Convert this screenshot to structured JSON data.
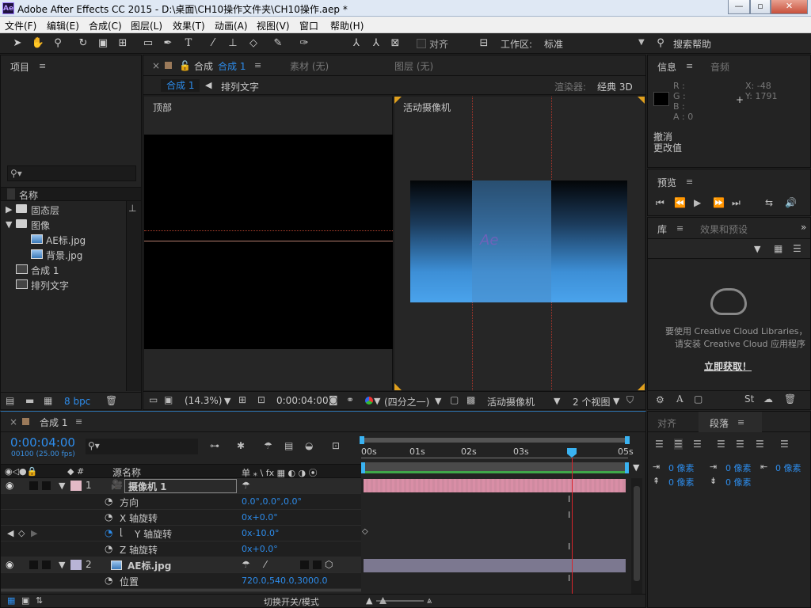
{
  "titlebar": {
    "app_icon": "Ae",
    "title": "Adobe After Effects CC 2015 - D:\\桌面\\CH10操作文件夹\\CH10操作.aep *",
    "minimize": "—",
    "maximize": "▫",
    "close": "✕"
  },
  "menu": [
    "文件(F)",
    "编辑(E)",
    "合成(C)",
    "图层(L)",
    "效果(T)",
    "动画(A)",
    "视图(V)",
    "窗口",
    "帮助(H)"
  ],
  "toolbar": {
    "align_label": "对齐",
    "workspace_label": "工作区:",
    "workspace_value": "标准",
    "search_help": "搜索帮助"
  },
  "project": {
    "title": "项目",
    "name_header": "名称",
    "items": [
      {
        "label": "固态层",
        "type": "folder",
        "expanded": false
      },
      {
        "label": "图像",
        "type": "folder",
        "expanded": true
      },
      {
        "label": "AE标.jpg",
        "type": "image",
        "indent": true
      },
      {
        "label": "背景.jpg",
        "type": "image",
        "indent": true
      },
      {
        "label": "合成 1",
        "type": "comp"
      },
      {
        "label": "排列文字",
        "type": "comp"
      }
    ],
    "bpc": "8 bpc"
  },
  "composition": {
    "tab_prefix": "合成",
    "tab_name": "合成 1",
    "tab_footage": "素材 (无)",
    "tab_layer": "图层 (无)",
    "breadcrumb_active": "合成 1",
    "breadcrumb_next": "排列文字",
    "renderer_label": "渲染器:",
    "renderer_value": "经典 3D",
    "view_left_label": "顶部",
    "view_right_label": "活动摄像机",
    "preview_text": "Ae",
    "footer": {
      "zoom": "(14.3%)",
      "timecode": "0:00:04:00",
      "resolution": "(四分之一)",
      "camera": "活动摄像机",
      "views": "2 个视图"
    }
  },
  "info": {
    "tab_info": "信息",
    "tab_audio": "音频",
    "r": "R :",
    "g": "G :",
    "b": "B :",
    "a": "A : 0",
    "x": "X: -48",
    "y": "Y: 1791",
    "line1": "撤消",
    "line2": "更改值"
  },
  "preview": {
    "title": "预览"
  },
  "library": {
    "tab_library": "库",
    "tab_effects": "效果和预设",
    "msg1": "要使用 Creative Cloud Libraries，",
    "msg2": "请安装 Creative Cloud 应用程序",
    "cta": "立即获取！"
  },
  "timeline": {
    "tab_name": "合成 1",
    "timecode": "0:00:04:00",
    "frames": "00100 (25.00 fps)",
    "col_source": "源名称",
    "col_switches": "单 ⁎ \\ fx ▦ ◐ ◑ ⦿",
    "ruler": [
      "00s",
      "01s",
      "02s",
      "03s",
      "05s"
    ],
    "playhead_fraction": 0.8,
    "layers": [
      {
        "num": "1",
        "name": "摄像机 1",
        "type": "camera",
        "color": "#e3b9c6"
      },
      {
        "prop": "方向",
        "value": "0.0°,0.0°,0.0°"
      },
      {
        "prop": "X 轴旋转",
        "value": "0x+0.0°"
      },
      {
        "prop": "Y 轴旋转",
        "value": "0x-10.0°",
        "keyframed": true
      },
      {
        "prop": "Z 轴旋转",
        "value": "0x+0.0°"
      },
      {
        "num": "2",
        "name": "AE标.jpg",
        "type": "image",
        "color": "#b8b4d6"
      },
      {
        "prop": "位置",
        "value": "720.0,540.0,3000.0"
      }
    ],
    "bottom_label": "切换开关/模式"
  },
  "paragraph": {
    "tab_align": "对齐",
    "tab_paragraph": "段落",
    "indent1": "0 像素",
    "indent2": "0 像素",
    "indent3": "0 像素",
    "space1": "0 像素",
    "space2": "0 像素"
  },
  "colors": {
    "accent": "#2d8ceb",
    "playhead": "#d8242b",
    "camera_bar": "#cf8aa0",
    "image_bar": "#7c7890"
  }
}
